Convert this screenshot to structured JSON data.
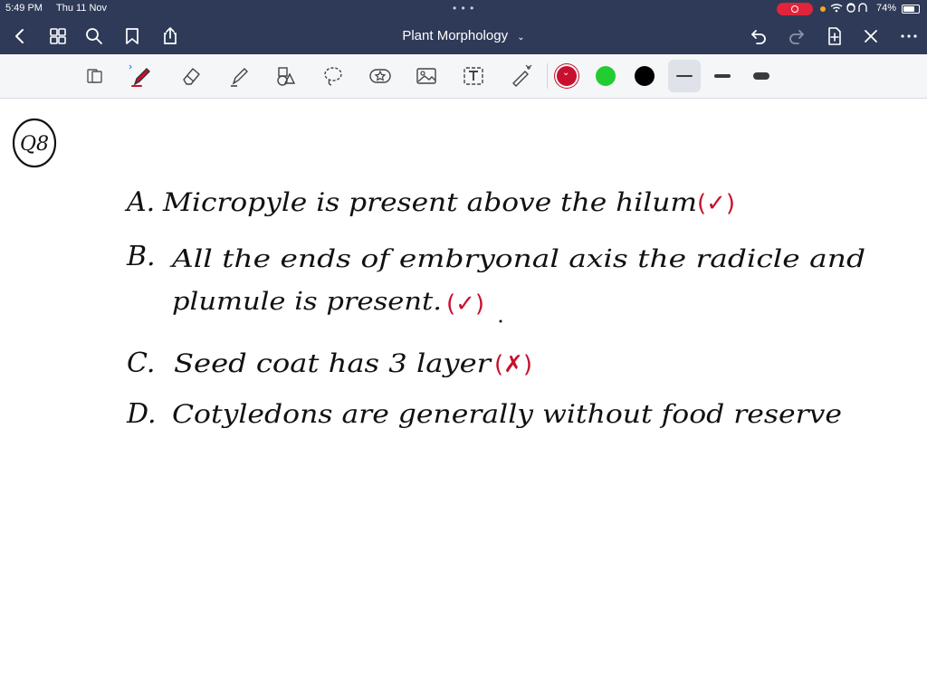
{
  "status": {
    "time": "5:49 PM",
    "date": "Thu 11 Nov",
    "battery_percent": "74%",
    "battery_level": 0.74
  },
  "nav": {
    "title": "Plant Morphology",
    "left_icons": [
      "back-chevron-icon",
      "grid-icon",
      "search-icon",
      "bookmark-icon",
      "share-icon"
    ],
    "right_icons": [
      "undo-icon",
      "redo-icon",
      "add-page-icon",
      "close-icon",
      "more-icon"
    ]
  },
  "toolbar": {
    "tools": [
      "page-read-icon",
      "pen-icon",
      "eraser-icon",
      "highlighter-icon",
      "shapes-icon",
      "lasso-icon",
      "sticker-icon",
      "image-icon",
      "text-icon",
      "laser-pointer-icon"
    ],
    "colors": [
      "#c8102e",
      "#22cc33",
      "#000000"
    ],
    "selected_color": "#c8102e",
    "stroke_sizes": [
      "thin",
      "medium",
      "thick"
    ],
    "selected_stroke": "thin"
  },
  "note": {
    "question_number": "Q8",
    "lines": [
      {
        "label": "A.",
        "text": "Micropyle is present above the hilum",
        "mark": "(✓)"
      },
      {
        "label": "B.",
        "text": "All the ends of embryonal axis the radicle and plumule is present.",
        "mark": "(✓)"
      },
      {
        "label": "C.",
        "text": "Seed coat has 3 layer",
        "mark": "(✗)"
      },
      {
        "label": "D.",
        "text": "Cotyledons are generally without food reserve",
        "mark": ""
      }
    ]
  }
}
